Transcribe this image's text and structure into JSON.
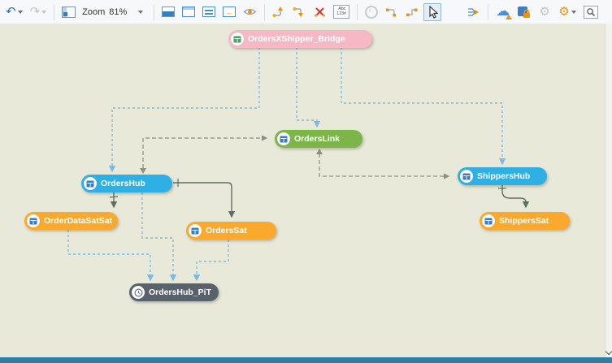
{
  "toolbar": {
    "zoom_label": "Zoom",
    "zoom_value": "81%",
    "abc_icon_line1": "Abc",
    "abc_icon_line2": "123#",
    "icon_names": [
      "undo",
      "redo",
      "panel-toggle",
      "zoom-level",
      "save-view",
      "window-top",
      "window-list",
      "window-back",
      "preview-eye",
      "connector-up",
      "connector-down",
      "delete-connector",
      "abc-123",
      "circle-tool",
      "connector-style-1",
      "connector-style-2",
      "cursor-tool",
      "bring-forward",
      "fan-out",
      "cloud-upload",
      "lock-object",
      "gear-disabled",
      "settings-gear",
      "zoom-region"
    ]
  },
  "icons": {
    "undo": "↶",
    "redo": "↷",
    "gear_disabled": "⚙",
    "gear_settings": "⚙",
    "cloud": "☁",
    "back_arrow": "←"
  },
  "diagram": {
    "nodes": [
      {
        "id": "bridge",
        "label": "OrdersXShipper_Bridge",
        "type": "bridge",
        "color": "#f6b8c5"
      },
      {
        "id": "orderslink",
        "label": "OrdersLink",
        "type": "link",
        "color": "#7cb648"
      },
      {
        "id": "ordershub",
        "label": "OrdersHub",
        "type": "hub",
        "color": "#2fb0e4"
      },
      {
        "id": "shippershub",
        "label": "ShippersHub",
        "type": "hub",
        "color": "#2fb0e4"
      },
      {
        "id": "orderdatasatsat",
        "label": "OrderDataSatSat",
        "type": "satellite",
        "color": "#fba92c"
      },
      {
        "id": "orderssat",
        "label": "OrdersSat",
        "type": "satellite",
        "color": "#fba92c"
      },
      {
        "id": "shipperssat",
        "label": "ShippersSat",
        "type": "satellite",
        "color": "#fba92c"
      },
      {
        "id": "ordershub_pit",
        "label": "OrdersHub_PiT",
        "type": "pit",
        "color": "#58626c"
      }
    ],
    "edges": [
      {
        "from": "OrdersXShipper_Bridge",
        "to": "OrdersHub",
        "style": "dashed-blue"
      },
      {
        "from": "OrdersXShipper_Bridge",
        "to": "OrdersLink",
        "style": "dashed-blue"
      },
      {
        "from": "OrdersXShipper_Bridge",
        "to": "ShippersHub",
        "style": "dashed-blue"
      },
      {
        "from": "OrdersHub",
        "to": "OrdersHub_PiT",
        "style": "dashed-blue"
      },
      {
        "from": "OrderDataSatSat",
        "to": "OrdersHub_PiT",
        "style": "dashed-blue"
      },
      {
        "from": "OrdersSat",
        "to": "OrdersHub_PiT",
        "style": "dashed-blue"
      },
      {
        "from": "OrdersHub",
        "to": "OrdersLink",
        "style": "dashed-gray"
      },
      {
        "from": "OrdersLink",
        "to": "ShippersHub",
        "style": "dashed-gray"
      },
      {
        "from": "OrdersHub",
        "to": "OrderDataSatSat",
        "style": "solid"
      },
      {
        "from": "OrdersHub",
        "to": "OrdersSat",
        "style": "solid"
      },
      {
        "from": "ShippersHub",
        "to": "ShippersSat",
        "style": "solid"
      }
    ]
  },
  "colors": {
    "canvas": "#e9e9da",
    "statusbar": "#2a7fa3",
    "edge_blue": "#7db9e0",
    "edge_gray": "#8d8d82",
    "edge_solid": "#5f6f5f",
    "hub": "#2fb0e4",
    "link": "#7cb648",
    "satellite": "#fba92c",
    "bridge": "#f6b8c5",
    "pit": "#58626c"
  }
}
